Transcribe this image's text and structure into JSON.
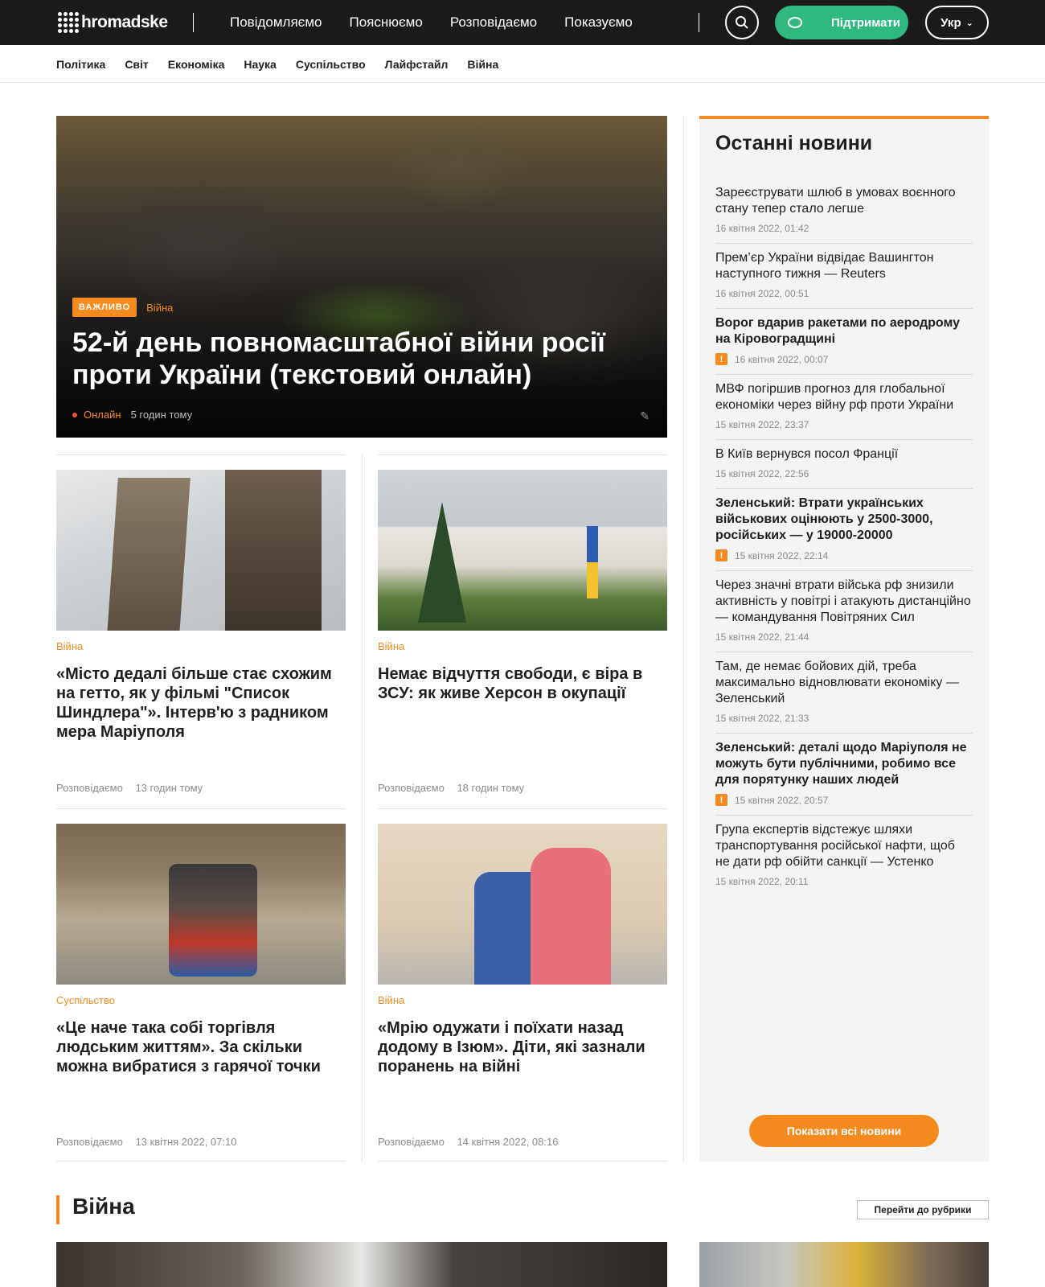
{
  "header": {
    "logo_text": "hromadske",
    "nav": [
      "Повідомляємо",
      "Пояснюємо",
      "Розповідаємо",
      "Показуємо"
    ],
    "search_icon": "search-icon",
    "support_label": "Підтримати",
    "lang_label": "Укр"
  },
  "subnav": [
    "Політика",
    "Світ",
    "Економіка",
    "Наука",
    "Суспільство",
    "Лайфстайл",
    "Війна"
  ],
  "hero": {
    "badge": "ВАЖЛИВО",
    "category": "Війна",
    "title": "52-й день повномасштабної війни росії проти України (текстовий онлайн)",
    "live": "Онлайн",
    "time": "5 годин тому"
  },
  "cards": [
    {
      "category": "Війна",
      "title": "«Місто дедалі більше стає схожим на гетто, як у фільмі \"Список Шиндлера\"». Інтерв'ю з радником мера Маріуполя",
      "section": "Розповідаємо",
      "time": "13 годин тому"
    },
    {
      "category": "Війна",
      "title": "Немає відчуття свободи, є віра в ЗСУ: як живе Херсон в окупації",
      "section": "Розповідаємо",
      "time": "18 годин тому"
    },
    {
      "category": "Суспільство",
      "title": "«Це наче така собі торгівля людським життям». За скільки можна вибратися з гарячої точки",
      "section": "Розповідаємо",
      "time": "13 квітня 2022, 07:10"
    },
    {
      "category": "Війна",
      "title": "«Мрію одужати і поїхати назад додому в Ізюм». Діти, які зазнали поранень на війні",
      "section": "Розповідаємо",
      "time": "14 квітня 2022, 08:16"
    }
  ],
  "sidebar": {
    "title": "Останні новини",
    "items": [
      {
        "title": "Зареєструвати шлюб в умовах воєнного стану тепер стало легше",
        "time": "16 квітня 2022, 01:42",
        "important": false
      },
      {
        "title": "Прем’єр України відвідає Вашингтон наступного тижня — Reuters",
        "time": "16 квітня 2022, 00:51",
        "important": false
      },
      {
        "title": "Ворог вдарив ракетами по аеродрому на Кіровоградщині",
        "time": "16 квітня 2022, 00:07",
        "important": true
      },
      {
        "title": "МВФ погіршив прогноз для глобальної економіки через війну рф проти України",
        "time": "15 квітня 2022, 23:37",
        "important": false
      },
      {
        "title": "В Київ вернувся посол Франції",
        "time": "15 квітня 2022, 22:56",
        "important": false
      },
      {
        "title": "Зеленський: Втрати українських військових оцінюють у 2500-3000, російських — у 19000-20000",
        "time": "15 квітня 2022, 22:14",
        "important": true
      },
      {
        "title": "Через значні втрати війська рф знизили активність у повітрі і атакують дистанційно — командування Повітряних Сил",
        "time": "15 квітня 2022, 21:44",
        "important": false
      },
      {
        "title": "Там, де немає бойових дій, треба максимально відновлювати економіку — Зеленський",
        "time": "15 квітня 2022, 21:33",
        "important": false
      },
      {
        "title": "Зеленський: деталі щодо Маріуполя не можуть бути публічними, робимо все для порятунку наших людей",
        "time": "15 квітня 2022, 20:57",
        "important": true
      },
      {
        "title": "Група експертів відстежує шляхи транспортування російської нафти, щоб не дати рф обійти санкції — Устенко",
        "time": "15 квітня 2022, 20:11",
        "important": false
      }
    ],
    "show_all_label": "Показати всі новини"
  },
  "section": {
    "title": "Війна",
    "link_label": "Перейти до рубрики"
  },
  "colors": {
    "accent": "#f58a1f",
    "support": "#2fb980",
    "topbar": "#1b1b1b"
  }
}
